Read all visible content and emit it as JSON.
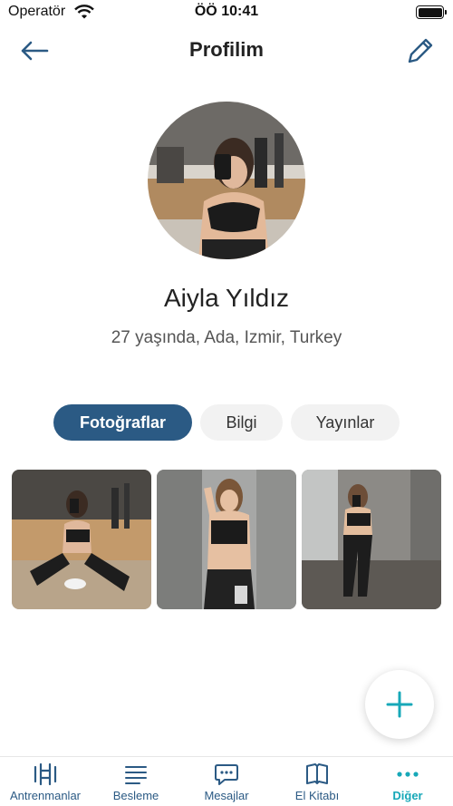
{
  "status_bar": {
    "carrier": "Operatör",
    "time": "ÖÖ 10:41"
  },
  "header": {
    "title": "Profilim",
    "back_icon": "arrow-left-icon",
    "edit_icon": "pencil-icon"
  },
  "profile": {
    "name": "Aiyla Yıldız",
    "details": "27 yaşında, Ada, Izmir, Turkey"
  },
  "tabs": [
    {
      "label": "Fotoğraflar",
      "active": true
    },
    {
      "label": "Bilgi",
      "active": false
    },
    {
      "label": "Yayınlar",
      "active": false
    }
  ],
  "photos": [
    {
      "description": "gym-floor-selfie"
    },
    {
      "description": "mirror-selfie"
    },
    {
      "description": "gym-hallway-selfie"
    }
  ],
  "fab": {
    "icon": "plus-icon"
  },
  "bottom_nav": [
    {
      "label": "Antrenmanlar",
      "icon": "dumbbell-icon",
      "active": false
    },
    {
      "label": "Besleme",
      "icon": "menu-lines-icon",
      "active": false
    },
    {
      "label": "Mesajlar",
      "icon": "chat-bubble-icon",
      "active": false
    },
    {
      "label": "El Kitabı",
      "icon": "book-icon",
      "active": false
    },
    {
      "label": "Diğer",
      "icon": "more-dots-icon",
      "active": true
    }
  ],
  "colors": {
    "primary": "#2b5a84",
    "accent": "#17a8b8",
    "tab_inactive_bg": "#f2f2f2"
  }
}
